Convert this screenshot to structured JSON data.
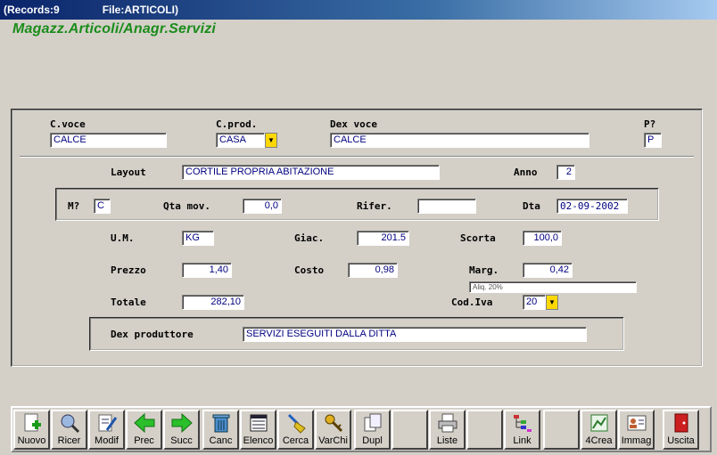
{
  "titlebar": {
    "records": "(Records:9",
    "file": "File:ARTICOLI)"
  },
  "heading": "Magazz.Articoli/Anagr.Servizi",
  "form": {
    "cvoce": {
      "label": "C.voce",
      "value": "CALCE"
    },
    "cprod": {
      "label": "C.prod.",
      "value": "CASA"
    },
    "dexvoce": {
      "label": "Dex voce",
      "value": "CALCE"
    },
    "p": {
      "label": "P?",
      "value": "P"
    },
    "layout": {
      "label": "Layout",
      "value": "CORTILE PROPRIA ABITAZIONE"
    },
    "anno": {
      "label": "Anno",
      "value": "2"
    },
    "m": {
      "label": "M?",
      "value": "C"
    },
    "qtamov": {
      "label": "Qta mov.",
      "value": "0,0"
    },
    "rifer": {
      "label": "Rifer.",
      "value": ""
    },
    "dta": {
      "label": "Dta",
      "value": "02-09-2002"
    },
    "um": {
      "label": "U.M.",
      "value": "KG"
    },
    "giac": {
      "label": "Giac.",
      "value": "201.5"
    },
    "scorta": {
      "label": "Scorta",
      "value": "100,0"
    },
    "prezzo": {
      "label": "Prezzo",
      "value": "1,40"
    },
    "costo": {
      "label": "Costo",
      "value": "0,98"
    },
    "marg": {
      "label": "Marg.",
      "value": "0,42"
    },
    "aliq": "Aliq. 20%",
    "totale": {
      "label": "Totale",
      "value": "282,10"
    },
    "codiva": {
      "label": "Cod.Iva",
      "value": "20"
    },
    "dexprod": {
      "label": "Dex produttore",
      "value": "SERVIZI ESEGUITI DALLA DITTA"
    }
  },
  "toolbar": [
    {
      "label": "Nuovo",
      "icon": "new-document-icon"
    },
    {
      "label": "Ricer",
      "icon": "search-globe-icon"
    },
    {
      "label": "Modif",
      "icon": "edit-document-icon"
    },
    {
      "label": "Prec",
      "icon": "arrow-left-icon"
    },
    {
      "label": "Succ",
      "icon": "arrow-right-icon"
    },
    {
      "label": "Canc",
      "icon": "trash-icon"
    },
    {
      "label": "Elenco",
      "icon": "list-icon"
    },
    {
      "label": "Cerca",
      "icon": "broom-icon"
    },
    {
      "label": "VarChi",
      "icon": "keys-icon"
    },
    {
      "label": "Dupl",
      "icon": "duplicate-icon"
    },
    {
      "label": "Liste",
      "icon": "printer-icon"
    },
    {
      "label": "Link",
      "icon": "tree-icon"
    },
    {
      "label": "4Crea",
      "icon": "create-icon"
    },
    {
      "label": "Immag",
      "icon": "id-card-icon"
    },
    {
      "label": "Uscita",
      "icon": "exit-door-icon"
    }
  ]
}
